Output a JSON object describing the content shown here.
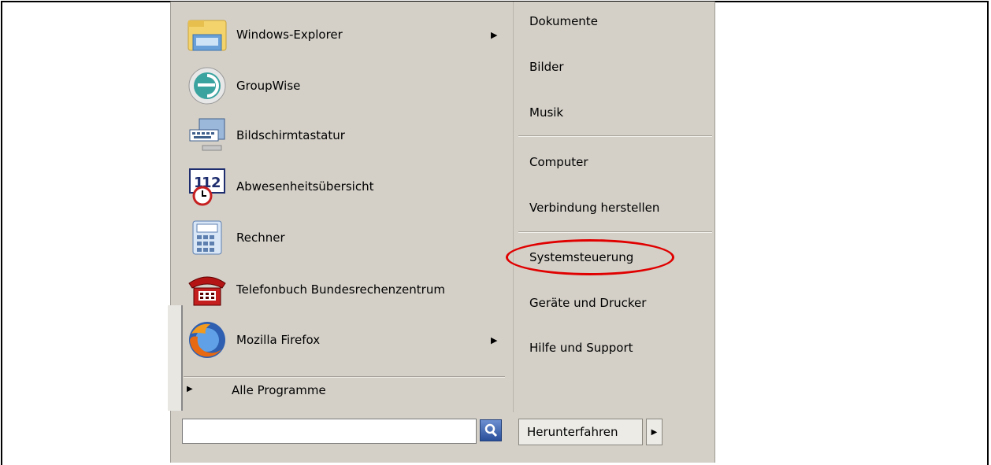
{
  "left_programs": [
    {
      "label": "Windows-Explorer",
      "icon": "folder-explorer-icon",
      "has_submenu": true
    },
    {
      "label": "GroupWise",
      "icon": "groupwise-icon",
      "has_submenu": false
    },
    {
      "label": "Bildschirmtastatur",
      "icon": "keyboard-monitor-icon",
      "has_submenu": false
    },
    {
      "label": "Abwesenheitsübersicht",
      "icon": "calendar-clock-icon",
      "has_submenu": false
    },
    {
      "label": "Rechner",
      "icon": "calculator-icon",
      "has_submenu": false
    },
    {
      "label": "Telefonbuch Bundesrechenzentrum",
      "icon": "telephone-icon",
      "has_submenu": false
    },
    {
      "label": "Mozilla Firefox",
      "icon": "firefox-icon",
      "has_submenu": true
    }
  ],
  "all_programs_label": "Alle Programme",
  "right_items": [
    {
      "label": "Dokumente"
    },
    {
      "label": "Bilder"
    },
    {
      "label": "Musik"
    },
    {
      "label": "Computer"
    },
    {
      "label": "Verbindung herstellen"
    },
    {
      "label": "Systemsteuerung",
      "highlighted": true
    },
    {
      "label": "Geräte und Drucker"
    },
    {
      "label": "Hilfe und Support"
    }
  ],
  "search": {
    "value": "",
    "placeholder": ""
  },
  "shutdown_label": "Herunterfahren",
  "colors": {
    "menu_bg": "#d4d0c8",
    "highlight_circle": "#e00000",
    "search_button": "#2a4f9a"
  }
}
